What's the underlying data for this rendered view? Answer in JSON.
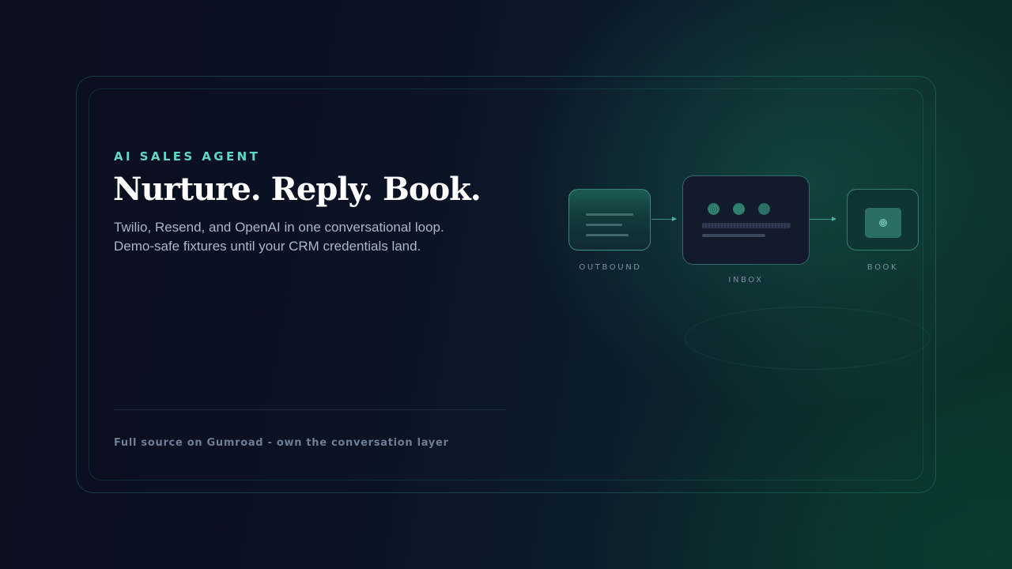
{
  "hero": {
    "eyebrow": "AI SALES AGENT",
    "headline": "Nurture. Reply. Book.",
    "subline_1": "Twilio, Resend, and OpenAI in one conversational loop.",
    "subline_2": "Demo-safe fixtures until your CRM credentials land.",
    "footer": "Full source on Gumroad - own the conversation layer"
  },
  "flow": {
    "steps": [
      {
        "label": "OUTBOUND",
        "icon": "message-lines-icon"
      },
      {
        "label": "INBOX",
        "icon": "inbox-dots-icon"
      },
      {
        "label": "BOOK",
        "icon": "calendar-booking-icon"
      }
    ]
  },
  "colors": {
    "accent": "#5fd8c8",
    "headline": "#ffffff",
    "body_text": "#a9b6cc",
    "muted": "#6f7d95",
    "background": "#0b1224"
  }
}
